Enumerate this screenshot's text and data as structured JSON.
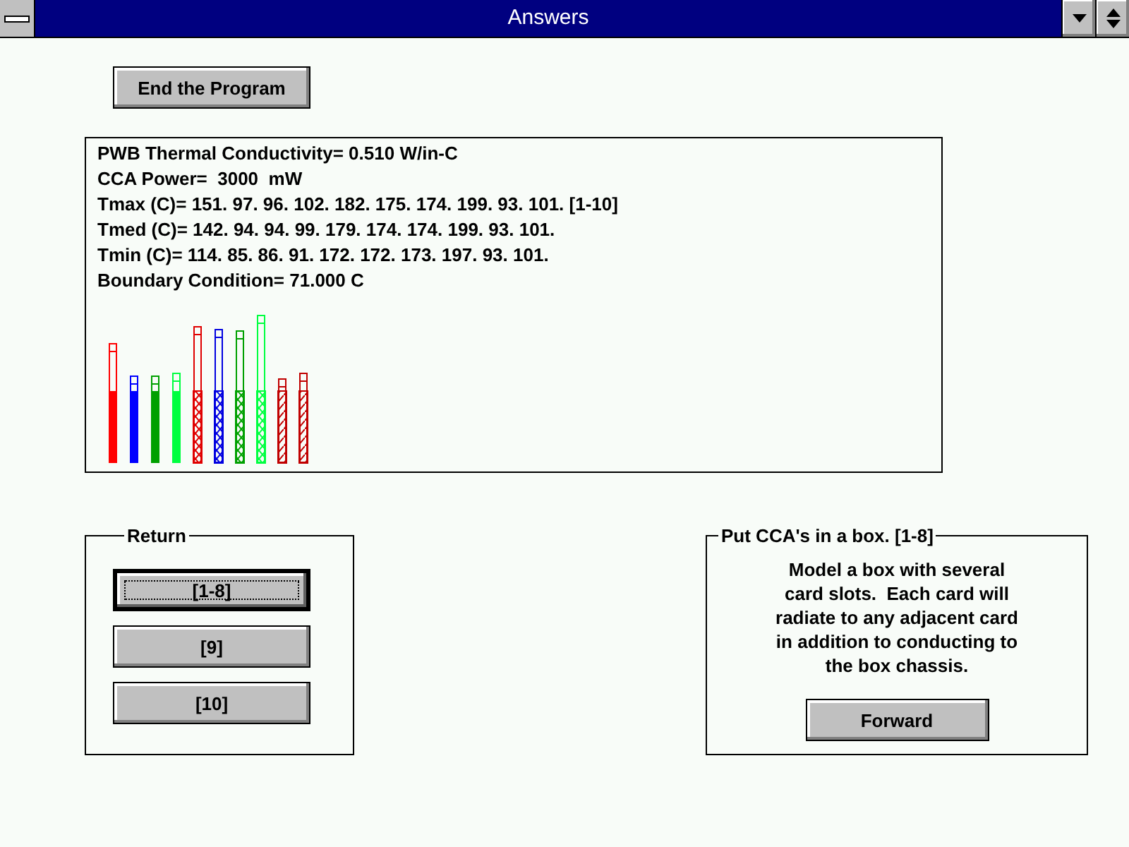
{
  "window": {
    "title": "Answers"
  },
  "end_button": {
    "label": "End the Program"
  },
  "results": {
    "lines": [
      "PWB Thermal Conductivity= 0.510 W/in-C",
      "CCA Power=  3000  mW",
      "Tmax (C)= 151. 97. 96. 102. 182. 175. 174. 199. 93. 101. [1-10]",
      "Tmed (C)= 142. 94. 94. 99. 179. 174. 174. 199. 93. 101.",
      "Tmin (C)= 114. 85. 86. 91. 172. 172. 173. 197. 93. 101.",
      "Boundary Condition= 71.000 C"
    ]
  },
  "return_group": {
    "title": "Return",
    "buttons": [
      {
        "label": "[1-8]",
        "selected": true
      },
      {
        "label": "[9]",
        "selected": false
      },
      {
        "label": "[10]",
        "selected": false
      }
    ]
  },
  "info_group": {
    "title": "Put CCA's in a box. [1-8]",
    "text": "Model a box with several\ncard slots.  Each card will\nradiate to any adjacent card\nin addition to conducting to\nthe box chassis.",
    "button": "Forward"
  }
}
